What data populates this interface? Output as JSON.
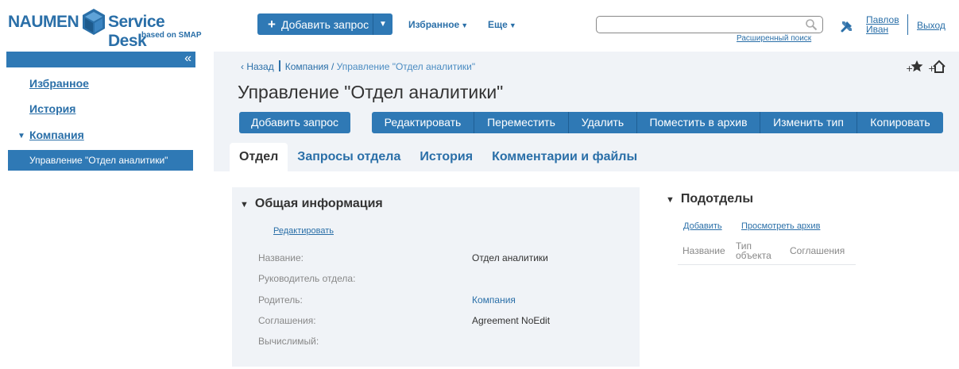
{
  "header": {
    "logo_left": "NAUMEN",
    "logo_right": "Service Desk",
    "logo_sub": "based on SMAP",
    "add_request": "Добавить запрос",
    "favorites": "Избранное",
    "more": "Еще",
    "search_value": "",
    "advanced_search": "Расширенный поиск",
    "user_first": "Павлов",
    "user_last": "Иван",
    "logout": "Выход"
  },
  "sidebar": {
    "collapse": "«",
    "favorites": "Избранное",
    "history": "История",
    "company": "Компания",
    "active_item": "Управление \"Отдел аналитики\""
  },
  "breadcrumb": {
    "back": "Назад",
    "company": "Компания /",
    "current": "Управление \"Отдел аналитики\""
  },
  "page": {
    "title": "Управление \"Отдел аналитики\"",
    "add_request": "Добавить запрос",
    "actions": [
      "Редактировать",
      "Переместить",
      "Удалить",
      "Поместить в архив",
      "Изменить тип",
      "Копировать"
    ],
    "tabs": [
      "Отдел",
      "Запросы отдела",
      "История",
      "Комментарии и файлы"
    ]
  },
  "general_info": {
    "title": "Общая информация",
    "edit": "Редактировать",
    "fields": [
      {
        "label": "Название:",
        "value": "Отдел аналитики"
      },
      {
        "label": "Руководитель отдела:",
        "value": ""
      },
      {
        "label": "Родитель:",
        "value": "Компания"
      },
      {
        "label": "Соглашения:",
        "value": "Agreement NoEdit"
      },
      {
        "label": "Вычислимый:",
        "value": ""
      }
    ]
  },
  "subdivisions": {
    "title": "Подотделы",
    "add": "Добавить",
    "view_archive": "Просмотреть архив",
    "columns": [
      "Название",
      "Тип",
      "объекта",
      "Соглашения"
    ]
  },
  "colors": {
    "primary": "#2f79b5",
    "link": "#2a6fa8",
    "panel_bg": "#f0f3f7"
  }
}
